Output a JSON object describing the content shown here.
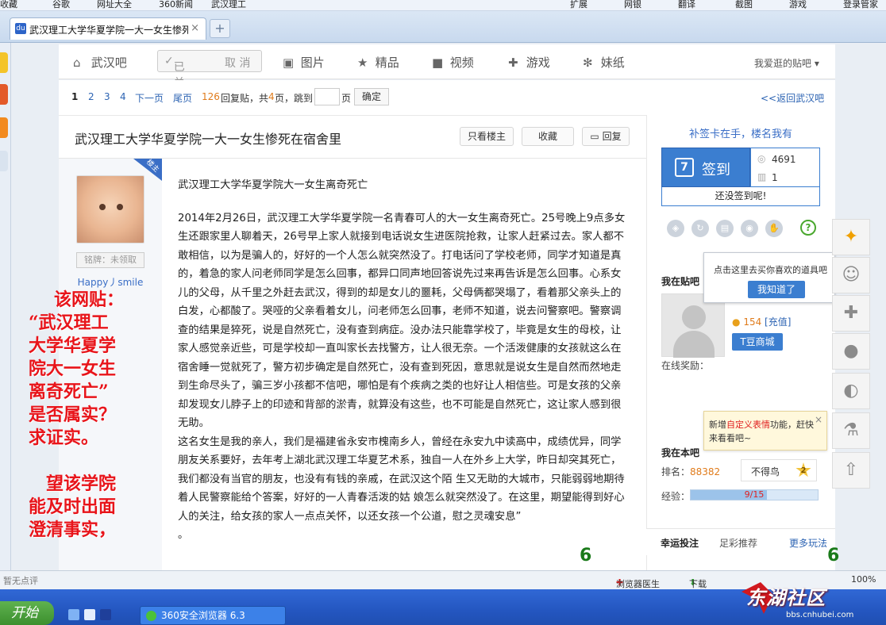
{
  "favorites_bar": [
    "收藏",
    "谷歌",
    "网址大全",
    "360新闻",
    "武汉理工",
    "扩展",
    "网银",
    "翻译",
    "截图",
    "游戏",
    "登录管家"
  ],
  "tab": {
    "title": "武汉理工大学华夏学院一大一女生惨死在宿舍里_武汉吧_百度贴吧",
    "close": "×",
    "new_tab": "+"
  },
  "nav": {
    "home": "武汉吧",
    "followed": "已关注",
    "unfollow": "取 消",
    "items": [
      "图片",
      "精品",
      "视频",
      "游戏",
      "妹纸"
    ],
    "liked": "我爱逛的贴吧"
  },
  "pager": {
    "pages": [
      "1",
      "2",
      "3",
      "4"
    ],
    "next": "下一页",
    "last": "尾页",
    "replies_count": "126",
    "replies_label": "回复贴，共",
    "total_pages": "4",
    "total_label": "页，跳到",
    "page_unit": "页",
    "confirm": "确定",
    "back": "<<返回武汉吧"
  },
  "thread": {
    "title": "武汉理工大学华夏学院一大一女生惨死在宿舍里",
    "only_op": "只看楼主",
    "collect": "收藏",
    "reply": "回复"
  },
  "author": {
    "corner": "楼主",
    "badge": "铭牌：未领取",
    "name": "Happy丿smile"
  },
  "post": {
    "heading": "武汉理工大学华夏学院大一女生离奇死亡",
    "paragraph1": "2014年2月26日，武汉理工大学华夏学院一名青春可人的大一女生离奇死亡。25号晚上9点多女生还跟家里人聊着天，26号早上家人就接到电话说女生进医院抢救，让家人赶紧过去。家人都不敢相信，以为是骗人的，好好的一个人怎么就突然没了。打电话问了学校老师，同学才知道是真的，着急的家人问老师同学是怎么回事，都异口同声地回答说先过来再告诉是怎么回事。心系女儿的父母，从千里之外赶去武汉，得到的却是女儿的噩耗，父母俩都哭塌了，看着那父亲头上的白发，心都酸了。哭哑的父亲看着女儿，问老师怎么回事，老师不知道，说去问警察吧。警察调查的结果是猝死，说是自然死亡，没有查到病症。没办法只能靠学校了，毕竟是女生的母校，让家人感觉亲近些，可是学校却一直叫家长去找警方，让人很无奈。一个活泼健康的女孩就这么在宿舍睡一觉就死了，警方初步确定是自然死亡，没有查到死因，意思就是说女生是自然而然地走到生命尽头了，骗三岁小孩都不信吧，哪怕是有个疾病之类的也好让人相信些。可是女孩的父亲却发现女儿脖子上的印迹和背部的淤青，就算没有这些，也不可能是自然死亡，这让家人感到很无助。",
    "paragraph2": "这名女生是我的亲人，我们是福建省永安市槐南乡人，曾经在永安九中读高中，成绩优异，同学朋友关系要好，去年考上湖北武汉理工华夏艺术系，独自一人在外乡上大学，昨日却突其死亡，我们都没有当官的朋友，也没有有钱的亲戚，在武汉这个陌 生又无助的大城市，只能弱弱地期待着人民警察能给个答案，好好的一人青春活泼的姑 娘怎么就突然没了。在这里，期望能得到好心人的关注，给女孩的家人一点点关怀，以还女孩一个公道，慰之灵魂安息”",
    "end": "。"
  },
  "overlay_red_text": [
    "该网贴：",
    "“武汉理工",
    "大学华夏学",
    "院大一女生",
    "离奇死亡”",
    "是否属实？",
    "求证实。",
    "",
    "　望该学院",
    "能及时出面",
    "澄清事实，"
  ],
  "marker_left": "6",
  "marker_right": "6",
  "sidebar": {
    "supp_text": "补签卡在手，楼名我有",
    "sign_label": "签到",
    "calendar_day": "7",
    "sign_count": "4691",
    "rank_count": "1",
    "not_signed": "还没签到呢!",
    "tool_icons": [
      "dice-icon",
      "refresh-icon",
      "card-icon",
      "target-icon",
      "hand-icon"
    ],
    "help": "?",
    "in_bar_title": "我在贴吧",
    "tdou_count": "154",
    "recharge": "[充值]",
    "tdou_shop": "T豆商城",
    "online_reward": "在线奖励：",
    "tooltip1_text": "点击这里去买你喜欢的道具吧",
    "tooltip1_btn": "我知道了",
    "tooltip2_pre": "新增",
    "tooltip2_highlight": "自定义表情",
    "tooltip2_post": "功能，赶快来看看吧~",
    "tooltip2_close": "×",
    "in_this_bar": "我在本吧",
    "rank_label": "排名：",
    "rank_value": "88382",
    "rank_title": "不得鸟",
    "rank_level": "2",
    "exp_label": "经验：",
    "exp_value": "9/15",
    "exp_fraction": 0.6,
    "tabs": [
      "幸运投注",
      "足彩推荐",
      "更多玩法"
    ]
  },
  "floatbar_icons": [
    "wand-icon",
    "smiley-icon",
    "plus-icon",
    "user-icon",
    "gamepad-icon",
    "flask-icon",
    "top-icon"
  ],
  "status": {
    "left": "暂无点评",
    "doctor": "浏览器医生",
    "download": "下载",
    "zoom": "100%"
  },
  "taskbar": {
    "start": "开始",
    "app": "360安全浏览器 6.3"
  },
  "watermark": {
    "name": "东湖社区",
    "url": "bbs.cnhubei.com"
  }
}
